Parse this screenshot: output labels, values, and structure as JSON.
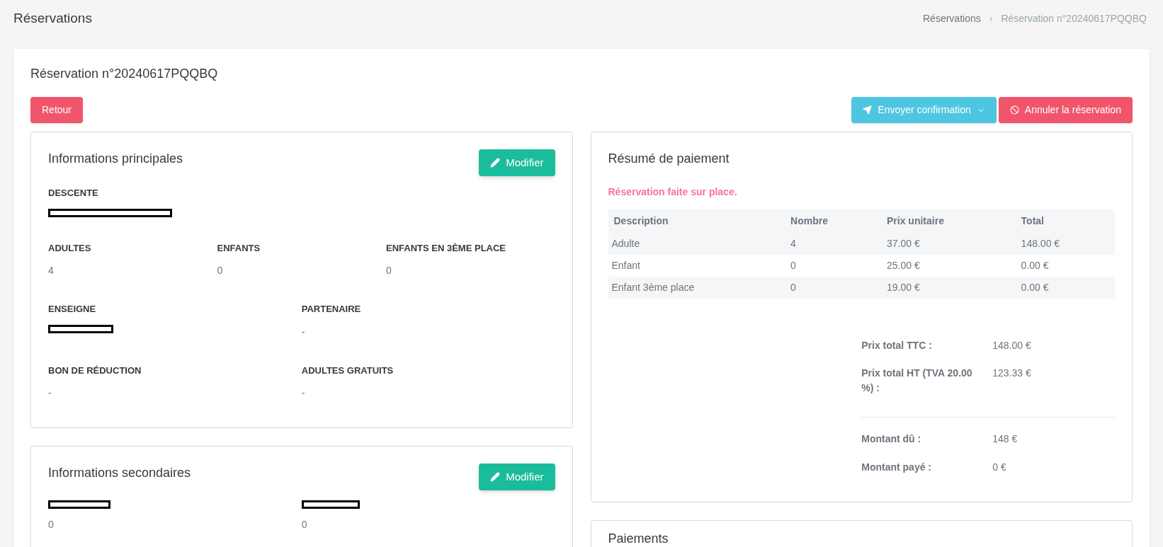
{
  "page_title": "Réservations",
  "breadcrumb": [
    {
      "label": "Réservations",
      "current": false
    },
    {
      "label": "Réservation n°20240617PQQBQ",
      "current": true
    }
  ],
  "breadcrumb_separator": "›",
  "reservation_title": "Réservation n°20240617PQQBQ",
  "back_button": "Retour",
  "actions": [
    {
      "kind": "send",
      "label": "Envoyer confirmation"
    },
    {
      "kind": "cancel",
      "label": "Annuler la réservation"
    }
  ],
  "main_info": {
    "title": "Informations principales",
    "edit_button": "Modifier",
    "rows": [
      [
        {
          "label": "DESCENTE",
          "value_redacted": true
        }
      ],
      [
        {
          "label": "ADULTES",
          "value": "4"
        },
        {
          "label": "ENFANTS",
          "value": "0"
        },
        {
          "label": "ENFANTS EN 3ÈME PLACE",
          "value": "0"
        }
      ],
      [
        {
          "label": "ENSEIGNE",
          "value_redacted": true
        },
        {
          "label": "PARTENAIRE",
          "value": "-"
        }
      ],
      [
        {
          "label": "BON DE RÉDUCTION",
          "value": "-"
        },
        {
          "label": "ADULTES GRATUITS",
          "value": "-"
        }
      ]
    ]
  },
  "secondary_info": {
    "title": "Informations secondaires",
    "edit_button": "Modifier",
    "fields": [
      {
        "label_redacted": true,
        "value": "0"
      },
      {
        "label_redacted": true,
        "value": "0"
      }
    ]
  },
  "payment_summary": {
    "title": "Résumé de paiement",
    "notice": "Réservation faite sur place.",
    "table": {
      "columns": [
        "Description",
        "Nombre",
        "Prix unitaire",
        "Total"
      ],
      "rows": [
        [
          "Adulte",
          "4",
          "37.00 €",
          "148.00 €"
        ],
        [
          "Enfant",
          "0",
          "25.00 €",
          "0.00 €"
        ],
        [
          "Enfant 3ème place",
          "0",
          "19.00 €",
          "0.00 €"
        ]
      ]
    },
    "totals": [
      {
        "label": "Prix total TTC :",
        "value": "148.00 €"
      },
      {
        "label": "Prix total HT (TVA 20.00 %) :",
        "value": "123.33 €"
      }
    ],
    "amounts": [
      {
        "label": "Montant dû :",
        "value": "148 €"
      },
      {
        "label": "Montant payé :",
        "value": "0 €"
      }
    ]
  },
  "payments": {
    "title": "Paiements"
  }
}
